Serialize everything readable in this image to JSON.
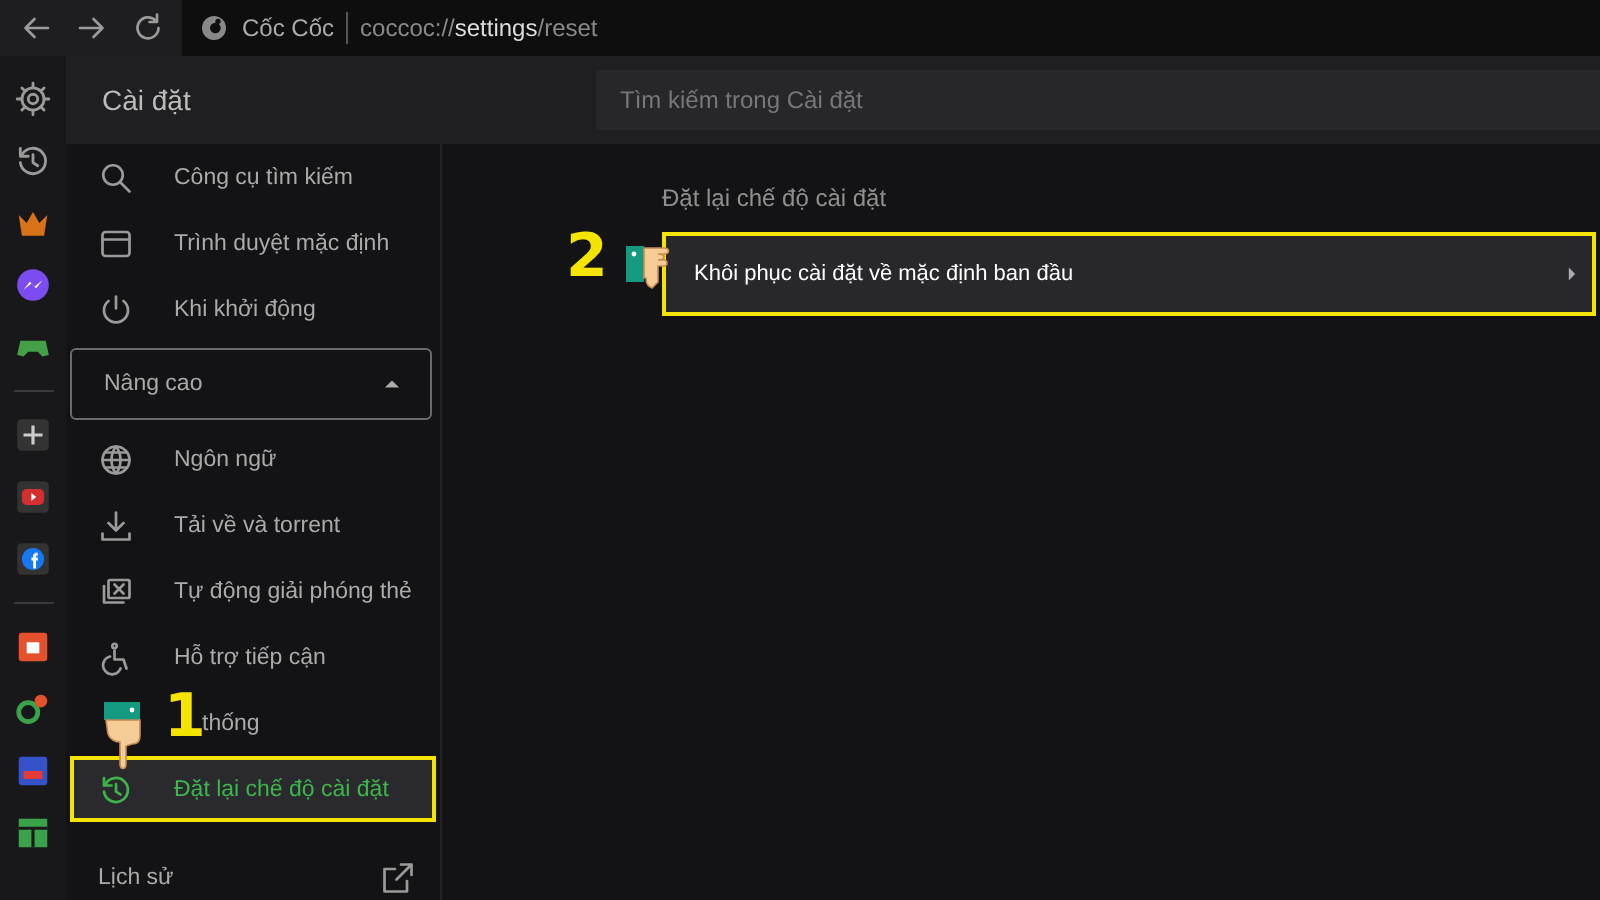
{
  "toolbar": {
    "site_name": "Cốc Cốc",
    "url": "coccoc://**settings**/reset"
  },
  "header": {
    "title": "Cài đặt",
    "search": {
      "placeholder": "Tìm kiếm trong Cài đặt"
    }
  },
  "sidebar": {
    "items": [
      {
        "kind": "search",
        "label": "Công cụ tìm kiếm",
        "selected": false
      },
      {
        "kind": "browser",
        "label": "Trình duyệt mặc định",
        "selected": false
      },
      {
        "kind": "power",
        "label": "Khi khởi động",
        "selected": false
      }
    ],
    "advanced": {
      "label": "Nâng cao",
      "expanded": true,
      "children": [
        {
          "kind": "globe",
          "label": "Ngôn ngữ",
          "selected": false
        },
        {
          "kind": "download",
          "label": "Tải về và torrent",
          "selected": false
        },
        {
          "kind": "tabs",
          "label": "Tự động giải phóng thẻ",
          "selected": false
        },
        {
          "kind": "accessibility",
          "label": "Hỗ trợ tiếp cận",
          "selected": false
        },
        {
          "label": "thống",
          "selected": false,
          "covered": true
        },
        {
          "kind": "reset",
          "label": "Đặt lại chế độ cài đặt",
          "selected": true,
          "step": "1"
        }
      ]
    },
    "history": {
      "label": "Lịch sử"
    }
  },
  "main": {
    "section_title": "Đặt lại chế độ cài đặt",
    "rows": [
      {
        "label": "Khôi phục cài đặt về mặc định ban đầu",
        "step": "2"
      }
    ]
  }
}
